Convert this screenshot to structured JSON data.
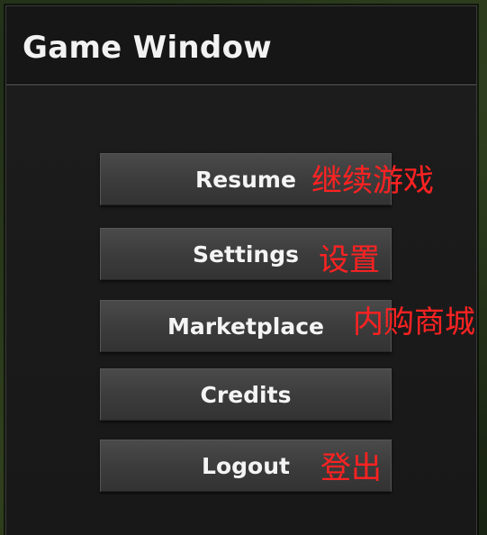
{
  "window": {
    "title": "Game Window"
  },
  "menu": {
    "buttons": [
      {
        "label": "Resume",
        "annotation": "继续游戏"
      },
      {
        "label": "Settings",
        "annotation": "设置"
      },
      {
        "label": "Marketplace",
        "annotation": "内购商城"
      },
      {
        "label": "Credits",
        "annotation": ""
      },
      {
        "label": "Logout",
        "annotation": "登出"
      }
    ]
  },
  "colors": {
    "annotation": "#ff2222",
    "button": "#3b3b3b",
    "window": "#191919"
  }
}
